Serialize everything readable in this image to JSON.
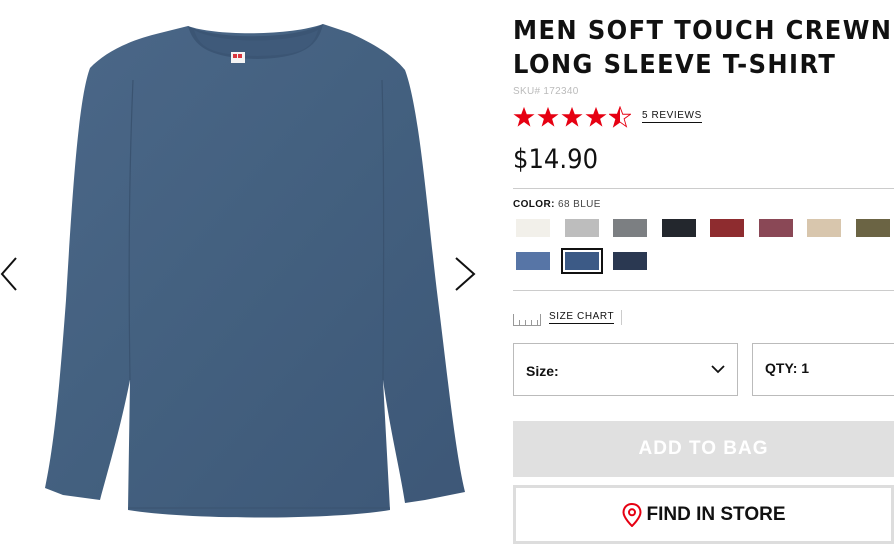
{
  "product": {
    "title_line1": "MEN SOFT TOUCH CREWNECK",
    "title_line2": "LONG SLEEVE T-SHIRT",
    "sku": "SKU# 172340",
    "rating": 4.5,
    "reviews_label": "5 REVIEWS",
    "price": "$14.90",
    "brand_tag": "UNIQLO"
  },
  "color": {
    "label": "COLOR:",
    "value": "68 BLUE",
    "swatches": [
      {
        "name": "off-white",
        "hex": "#f2f0ea"
      },
      {
        "name": "light-gray",
        "hex": "#bdbdbd"
      },
      {
        "name": "gray",
        "hex": "#7c7f82"
      },
      {
        "name": "black",
        "hex": "#23272d"
      },
      {
        "name": "red",
        "hex": "#8e2c2f"
      },
      {
        "name": "wine",
        "hex": "#8a4856"
      },
      {
        "name": "beige",
        "hex": "#d8c6ad"
      },
      {
        "name": "olive",
        "hex": "#6b6444"
      },
      {
        "name": "light-blue",
        "hex": "#5775a6"
      },
      {
        "name": "blue",
        "hex": "#3c5a86",
        "selected": true
      },
      {
        "name": "navy",
        "hex": "#2a3851"
      }
    ]
  },
  "size_chart": {
    "label": "SIZE CHART"
  },
  "size": {
    "label": "Size:"
  },
  "qty": {
    "label": "QTY: 1"
  },
  "buttons": {
    "add_to_bag": "ADD TO BAG",
    "find_in_store": "FIND IN STORE"
  },
  "colors": {
    "star": "#e60012",
    "store_pin": "#e60012",
    "shirt": "#44607f",
    "add_button_bg": "#e0e0e0"
  }
}
